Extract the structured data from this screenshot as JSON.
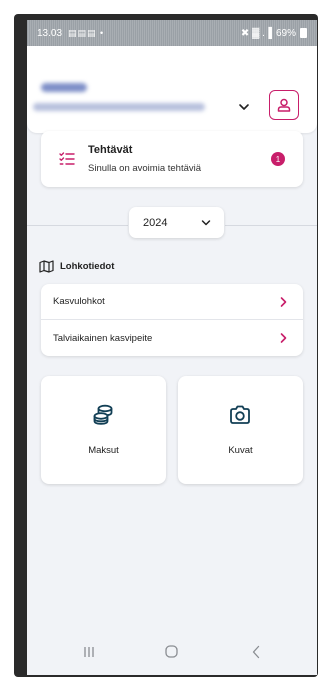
{
  "status_bar": {
    "time": "13.03",
    "notification_icons": "▤▤▤ •",
    "signal_text": "✖ ▓ .▐",
    "battery": "69%",
    "battery_icon": "battery-icon"
  },
  "header": {
    "chevron_icon": "chevron-down-icon",
    "profile_icon": "user-icon"
  },
  "tasks": {
    "title": "Tehtävät",
    "subtitle": "Sinulla on avoimia tehtäviä",
    "badge_count": "1",
    "icon": "task-list-icon"
  },
  "year_selector": {
    "value": "2024",
    "icon": "chevron-down-icon"
  },
  "section": {
    "title": "Lohkotiedot",
    "icon": "map-icon"
  },
  "list": {
    "items": [
      {
        "label": "Kasvulohkot",
        "icon": "chevron-right-icon"
      },
      {
        "label": "Talviaikainen kasvipeite",
        "icon": "chevron-right-icon"
      }
    ]
  },
  "tiles": [
    {
      "label": "Maksut",
      "icon": "coins-icon"
    },
    {
      "label": "Kuvat",
      "icon": "camera-icon"
    }
  ],
  "nav_bar": {
    "recent_icon": "recent-apps-icon",
    "home_icon": "home-icon",
    "back_icon": "back-icon"
  },
  "colors": {
    "accent": "#c81e6a",
    "icon_dark": "#123f55",
    "background": "#f1f3f7"
  }
}
